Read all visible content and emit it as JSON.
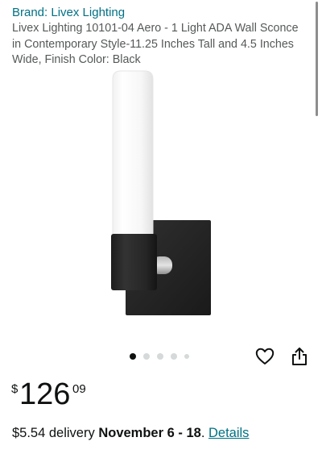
{
  "product": {
    "brand": "Brand: Livex Lighting",
    "title": "Livex Lighting 10101-04 Aero - 1 Light ADA Wall Sconce in Contemporary Style-11.25 Inches Tall and 4.5 Inches Wide, Finish Color: Black",
    "image_icon": "wall-sconce-product-image"
  },
  "carousel": {
    "total_images": 5,
    "active_index": 0
  },
  "actions": {
    "wishlist_icon": "heart-icon",
    "share_icon": "share-icon"
  },
  "price": {
    "symbol": "$",
    "whole": "126",
    "fraction": "09"
  },
  "delivery": {
    "prefix": "$5.54 delivery ",
    "date": "November 6 - 18",
    "separator": ". ",
    "details_link": "Details"
  },
  "colors": {
    "link": "#007185",
    "text": "#0f1111",
    "secondary_text": "#565959",
    "product_finish": "#2a2a2a"
  }
}
